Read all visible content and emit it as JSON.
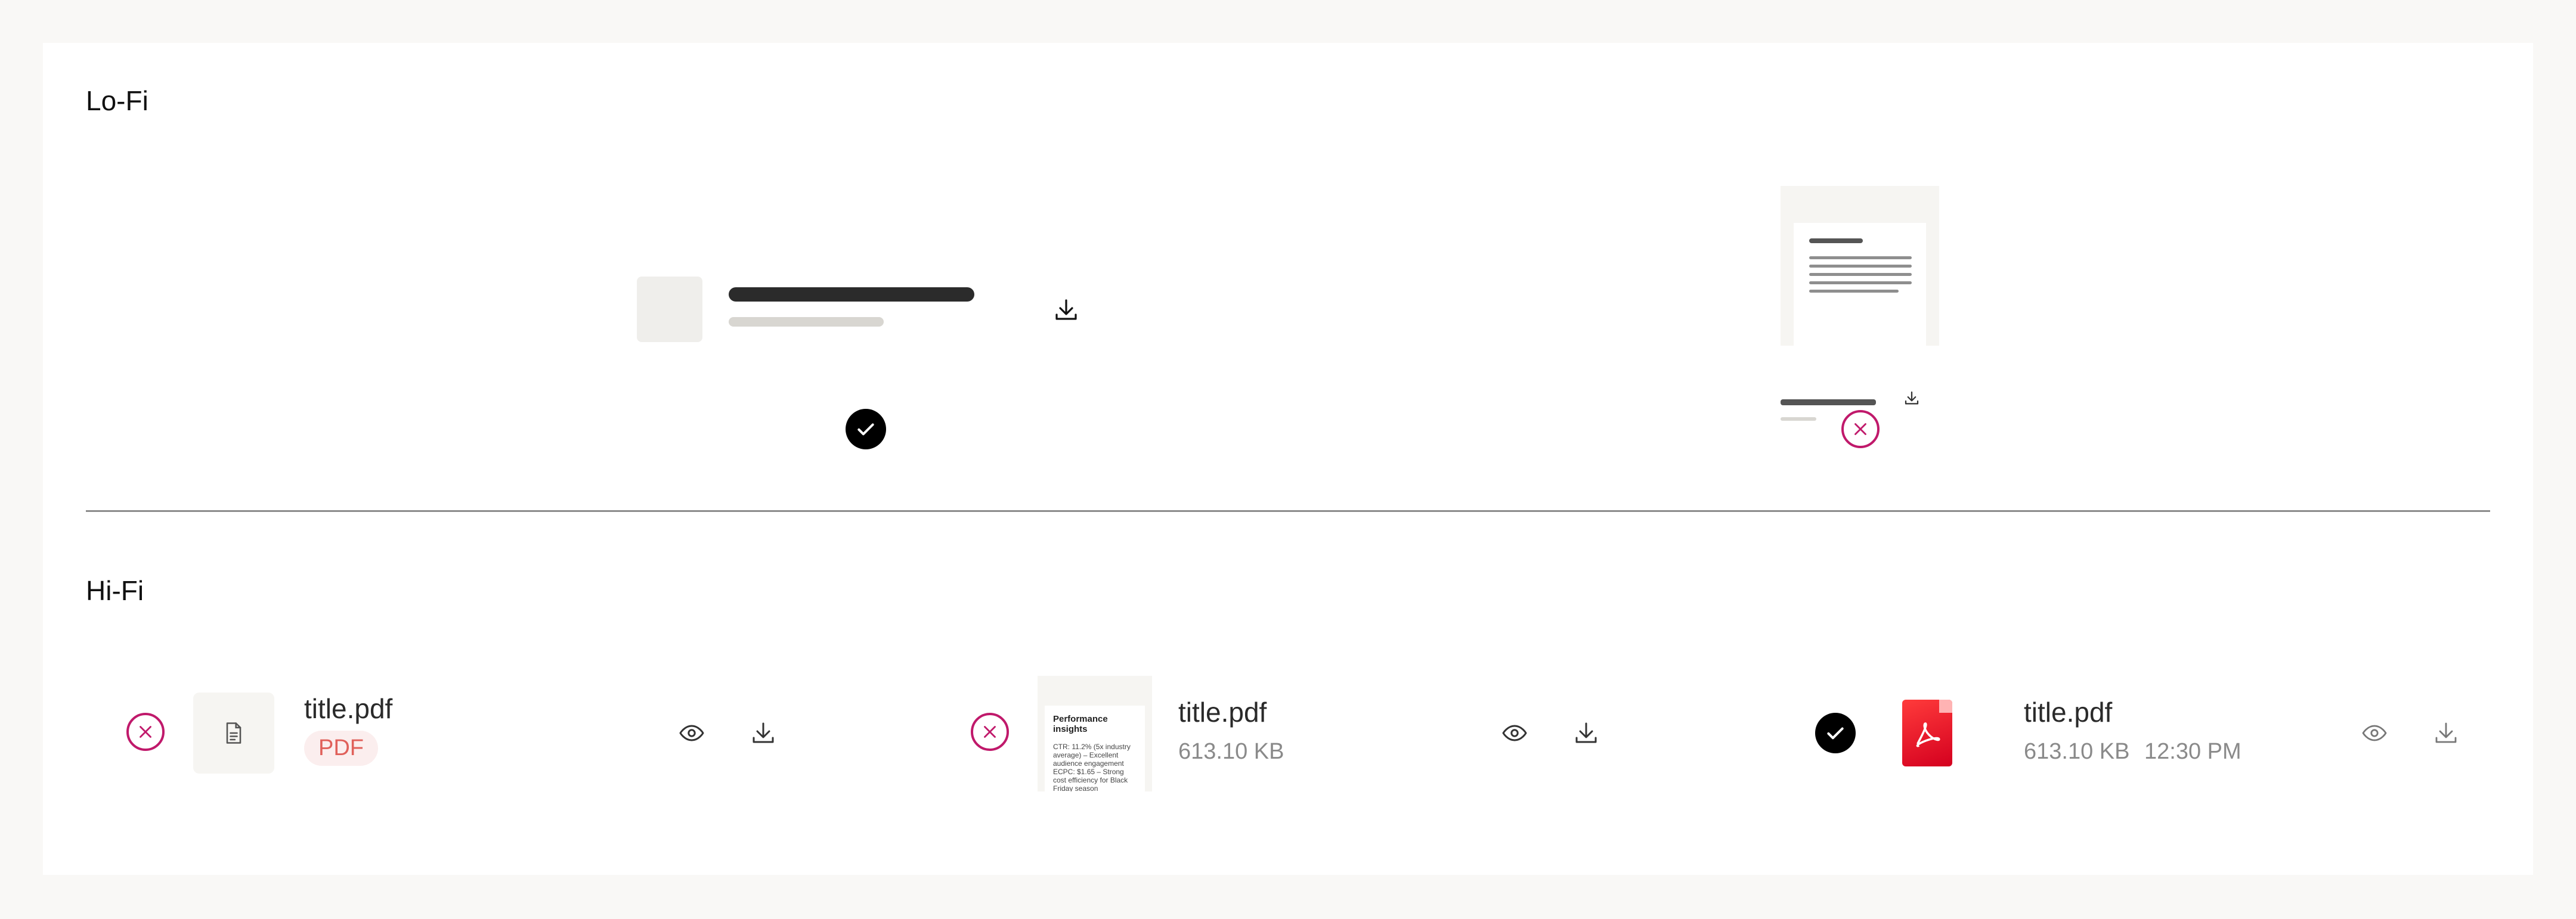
{
  "sections": {
    "lofi_title": "Lo-Fi",
    "hifi_title": "Hi-Fi"
  },
  "lofi": {
    "list_variant": {
      "status": "correct",
      "icon": "download-icon",
      "status_icon": "check-icon"
    },
    "card_variant": {
      "status": "incorrect",
      "icon": "download-icon",
      "status_icon": "x-icon"
    }
  },
  "hifi": {
    "items": [
      {
        "status": "incorrect",
        "status_icon": "x-icon",
        "thumb_icon": "document-icon",
        "title": "title.pdf",
        "badge": "PDF",
        "actions": [
          "eye-icon",
          "download-icon"
        ]
      },
      {
        "status": "incorrect",
        "status_icon": "x-icon",
        "thumb_title": "Performance insights",
        "thumb_body": "CTR: 11.2% (5x industry average) – Excellent audience engagement ECPC: $1.65 – Strong cost efficiency for Black Friday season",
        "title": "title.pdf",
        "size": "613.10 KB",
        "actions": [
          "eye-icon",
          "download-icon"
        ]
      },
      {
        "status": "correct",
        "status_icon": "check-icon",
        "thumb_icon": "pdf-icon",
        "title": "title.pdf",
        "size": "613.10 KB",
        "time": "12:30 PM",
        "actions": [
          "eye-icon",
          "download-icon"
        ]
      }
    ]
  },
  "colors": {
    "page_bg": "#f9f8f6",
    "card_bg": "#ffffff",
    "error_magenta": "#c0196b",
    "badge_text": "#e0605a",
    "badge_bg": "#fbeeee",
    "pdf_red": "#e8001c"
  }
}
